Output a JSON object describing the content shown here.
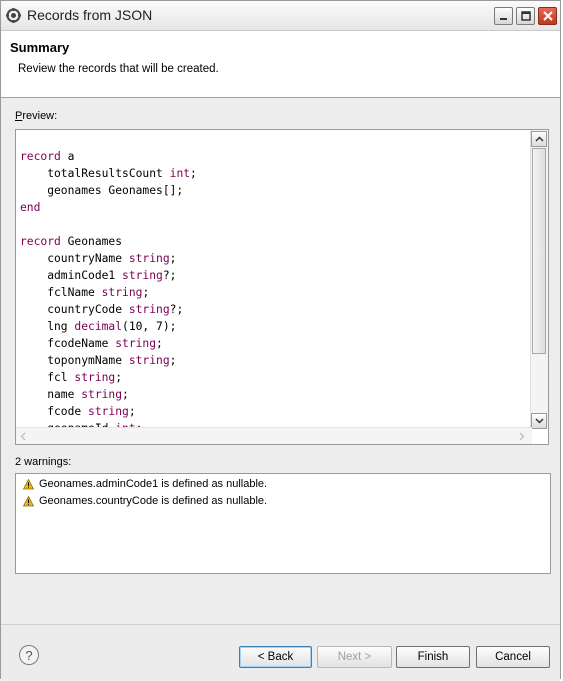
{
  "window": {
    "title": "Records from JSON"
  },
  "header": {
    "title": "Summary",
    "description": "Review the records that will be created."
  },
  "preview": {
    "label": "Preview:",
    "code_lines": [
      {
        "kw": "record",
        "rest": " a"
      },
      {
        "indent": "    ",
        "text": "totalResultsCount ",
        "kw": "int",
        "rest": ";"
      },
      {
        "indent": "    ",
        "text": "geonames Geonames[];"
      },
      {
        "kw": "end"
      },
      {
        "text": ""
      },
      {
        "kw": "record",
        "rest": " Geonames"
      },
      {
        "indent": "    ",
        "text": "countryName ",
        "kw": "string",
        "rest": ";"
      },
      {
        "indent": "    ",
        "text": "adminCode1 ",
        "kw": "string",
        "rest": "?;"
      },
      {
        "indent": "    ",
        "text": "fclName ",
        "kw": "string",
        "rest": ";"
      },
      {
        "indent": "    ",
        "text": "countryCode ",
        "kw": "string",
        "rest": "?;"
      },
      {
        "indent": "    ",
        "text": "lng ",
        "kw": "decimal",
        "rest": "(10, 7);"
      },
      {
        "indent": "    ",
        "text": "fcodeName ",
        "kw": "string",
        "rest": ";"
      },
      {
        "indent": "    ",
        "text": "toponymName ",
        "kw": "string",
        "rest": ";"
      },
      {
        "indent": "    ",
        "text": "fcl ",
        "kw": "string",
        "rest": ";"
      },
      {
        "indent": "    ",
        "text": "name ",
        "kw": "string",
        "rest": ";"
      },
      {
        "indent": "    ",
        "text": "fcode ",
        "kw": "string",
        "rest": ";"
      },
      {
        "indent": "    ",
        "text": "geonameId ",
        "kw": "int",
        "rest": ";"
      }
    ]
  },
  "warnings": {
    "label": "2 warnings:",
    "items": [
      "Geonames.adminCode1 is defined as nullable.",
      "Geonames.countryCode is defined as nullable."
    ]
  },
  "buttons": {
    "back_label": "< Back",
    "next_label": "Next >",
    "finish_label": "Finish",
    "cancel_label": "Cancel",
    "help_label": "?"
  },
  "colors": {
    "keyword": "#7a0055",
    "warning_icon": "#e8b820"
  },
  "icons": {
    "title": "app-icon",
    "warning": "warning-icon",
    "help": "help-icon"
  }
}
